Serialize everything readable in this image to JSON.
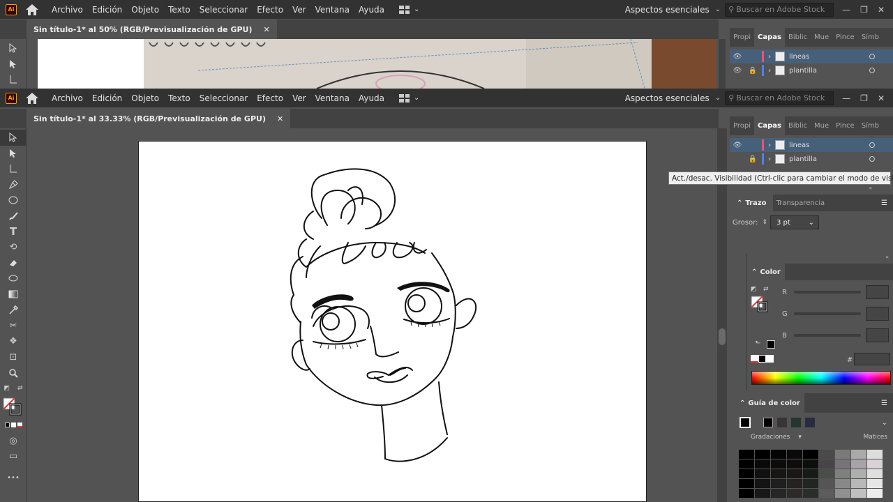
{
  "app": {
    "logo": "Ai"
  },
  "menu": [
    "Archivo",
    "Edición",
    "Objeto",
    "Texto",
    "Seleccionar",
    "Efecto",
    "Ver",
    "Ventana",
    "Ayuda"
  ],
  "workspace": "Aspectos esenciales",
  "search_placeholder": "Buscar en Adobe Stock",
  "back_window": {
    "doc_tab": "Sin título-1* al 50% (RGB/Previsualización de GPU)"
  },
  "front_window": {
    "doc_tab": "Sin título-1* al 33.33% (RGB/Previsualización de GPU)"
  },
  "panel_tabs": [
    "Propi",
    "Capas",
    "Biblic",
    "Mue",
    "Pince",
    "Símb"
  ],
  "active_panel_tab": "Capas",
  "layers": [
    {
      "name": "lineas",
      "color": "#ff4f6f",
      "selected": true
    },
    {
      "name": "plantilla",
      "color": "#4f7fff",
      "selected": false
    }
  ],
  "tooltip": "Act./desac. Visibilidad (Ctrl-clic para cambiar el modo de vista)",
  "stroke_panel": {
    "tabs": [
      "Trazo",
      "Transparencia"
    ],
    "weight_label": "Grosor:",
    "weight_value": "3 pt"
  },
  "color_panel": {
    "title": "Color",
    "channels": [
      "R",
      "G",
      "B"
    ],
    "hex_label": "#"
  },
  "color_guide": {
    "title": "Guía de color",
    "gradations": "Gradaciones",
    "shades": "Matices"
  },
  "toolbar_more": "•••"
}
